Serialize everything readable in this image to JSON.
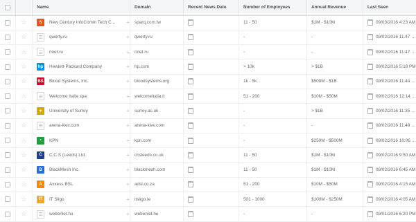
{
  "columns": {
    "name": "Name",
    "domain": "Domain",
    "news": "Recent News Date",
    "employees": "Number of Employees",
    "revenue": "Annual Revenue",
    "seen": "Last Seen"
  },
  "rows": [
    {
      "name": "New Century InfoComm Tech C...",
      "logo": "orange-s-logo",
      "logo_color": "#e8531c",
      "logo_text": "S",
      "domain": "sparq.com.tw",
      "employees": "11 - 50",
      "revenue": "$1M - $10M",
      "seen": "09/03/2016 4:23 AM"
    },
    {
      "name": "qwerty.ru",
      "logo": "placeholder-logo",
      "domain": "qwerty.ru",
      "employees": "-",
      "revenue": "-",
      "seen": "09/02/2016 11:47 PM"
    },
    {
      "name": "rinet.ru",
      "logo": "placeholder-logo",
      "domain": "rinet.ru",
      "employees": "-",
      "revenue": "-",
      "seen": "09/02/2016 11:47 PM"
    },
    {
      "name": "Hewlett-Packard Company",
      "logo": "hp-logo",
      "logo_color": "#0096d6",
      "logo_text": "hp",
      "domain": "hp.com",
      "employees": "> 10k",
      "revenue": "> $1B",
      "seen": "09/02/2016 5:18 PM"
    },
    {
      "name": "Blood Systems, Inc.",
      "logo": "blood-systems-logo",
      "logo_color": "#c8102e",
      "logo_text": "BS",
      "domain": "bloodsystems.org",
      "employees": "1k - 5k",
      "revenue": "$500M - $1B",
      "seen": "09/02/2016 11:44 AM"
    },
    {
      "name": "Welcome Italia spa",
      "logo": "placeholder-logo",
      "domain": "welcomeitalia.it",
      "employees": "51 - 200",
      "revenue": "$10M - $50M",
      "seen": "09/02/2016 12:14 PM"
    },
    {
      "name": "University of Surrey",
      "logo": "surrey-stag-logo",
      "logo_color": "#d4a800",
      "logo_text": "✦",
      "domain": "surrey.ac.uk",
      "employees": "-",
      "revenue": "> $1B",
      "seen": "09/02/2016 11:35 AM"
    },
    {
      "name": "arena-kiev.com",
      "logo": "placeholder-logo",
      "domain": "arena-kiev.com",
      "employees": "-",
      "revenue": "-",
      "seen": "09/02/2016 11:49 AM"
    },
    {
      "name": "KPN",
      "logo": "kpn-logo",
      "logo_color": "#1e9e3e",
      "logo_text": "•",
      "domain": "kpn.com",
      "employees": "-",
      "revenue": "$250M - $500M",
      "seen": "09/02/2016 10:06 AM"
    },
    {
      "name": "C.C.S (Leeds) Ltd.",
      "logo": "ccs-leeds-logo",
      "logo_color": "#1f3f8f",
      "logo_text": "C",
      "domain": "ccsleeds.co.uk",
      "employees": "11 - 50",
      "revenue": "$1M - $10M",
      "seen": "09/02/2016 9:50 AM"
    },
    {
      "name": "BlackMesh Inc.",
      "logo": "blackmesh-logo",
      "logo_color": "#2a6fd6",
      "logo_text": "B",
      "domain": "blackmesh.com",
      "employees": "11 - 50",
      "revenue": "$1M - $10M",
      "seen": "09/02/2016 6:45 AM"
    },
    {
      "name": "Axxess BSL",
      "logo": "axxess-logo",
      "logo_color": "#f08c00",
      "logo_text": "A",
      "domain": "adsl.co.za",
      "employees": "51 - 200",
      "revenue": "$10M - $50M",
      "seen": "09/02/2016 4:15 AM"
    },
    {
      "name": "IT Sligo",
      "logo": "it-sligo-logo",
      "logo_color": "#f5a623",
      "logo_text": "IT",
      "domain": "itsligo.ie",
      "employees": "501 - 1000",
      "revenue": "$100M - $250M",
      "seen": "09/02/2016 4:05 AM"
    },
    {
      "name": "webenlet.hu",
      "logo": "placeholder-logo",
      "domain": "webenlet.hu",
      "employees": "-",
      "revenue": "-",
      "seen": "09/01/2016 6:20 PM"
    }
  ]
}
